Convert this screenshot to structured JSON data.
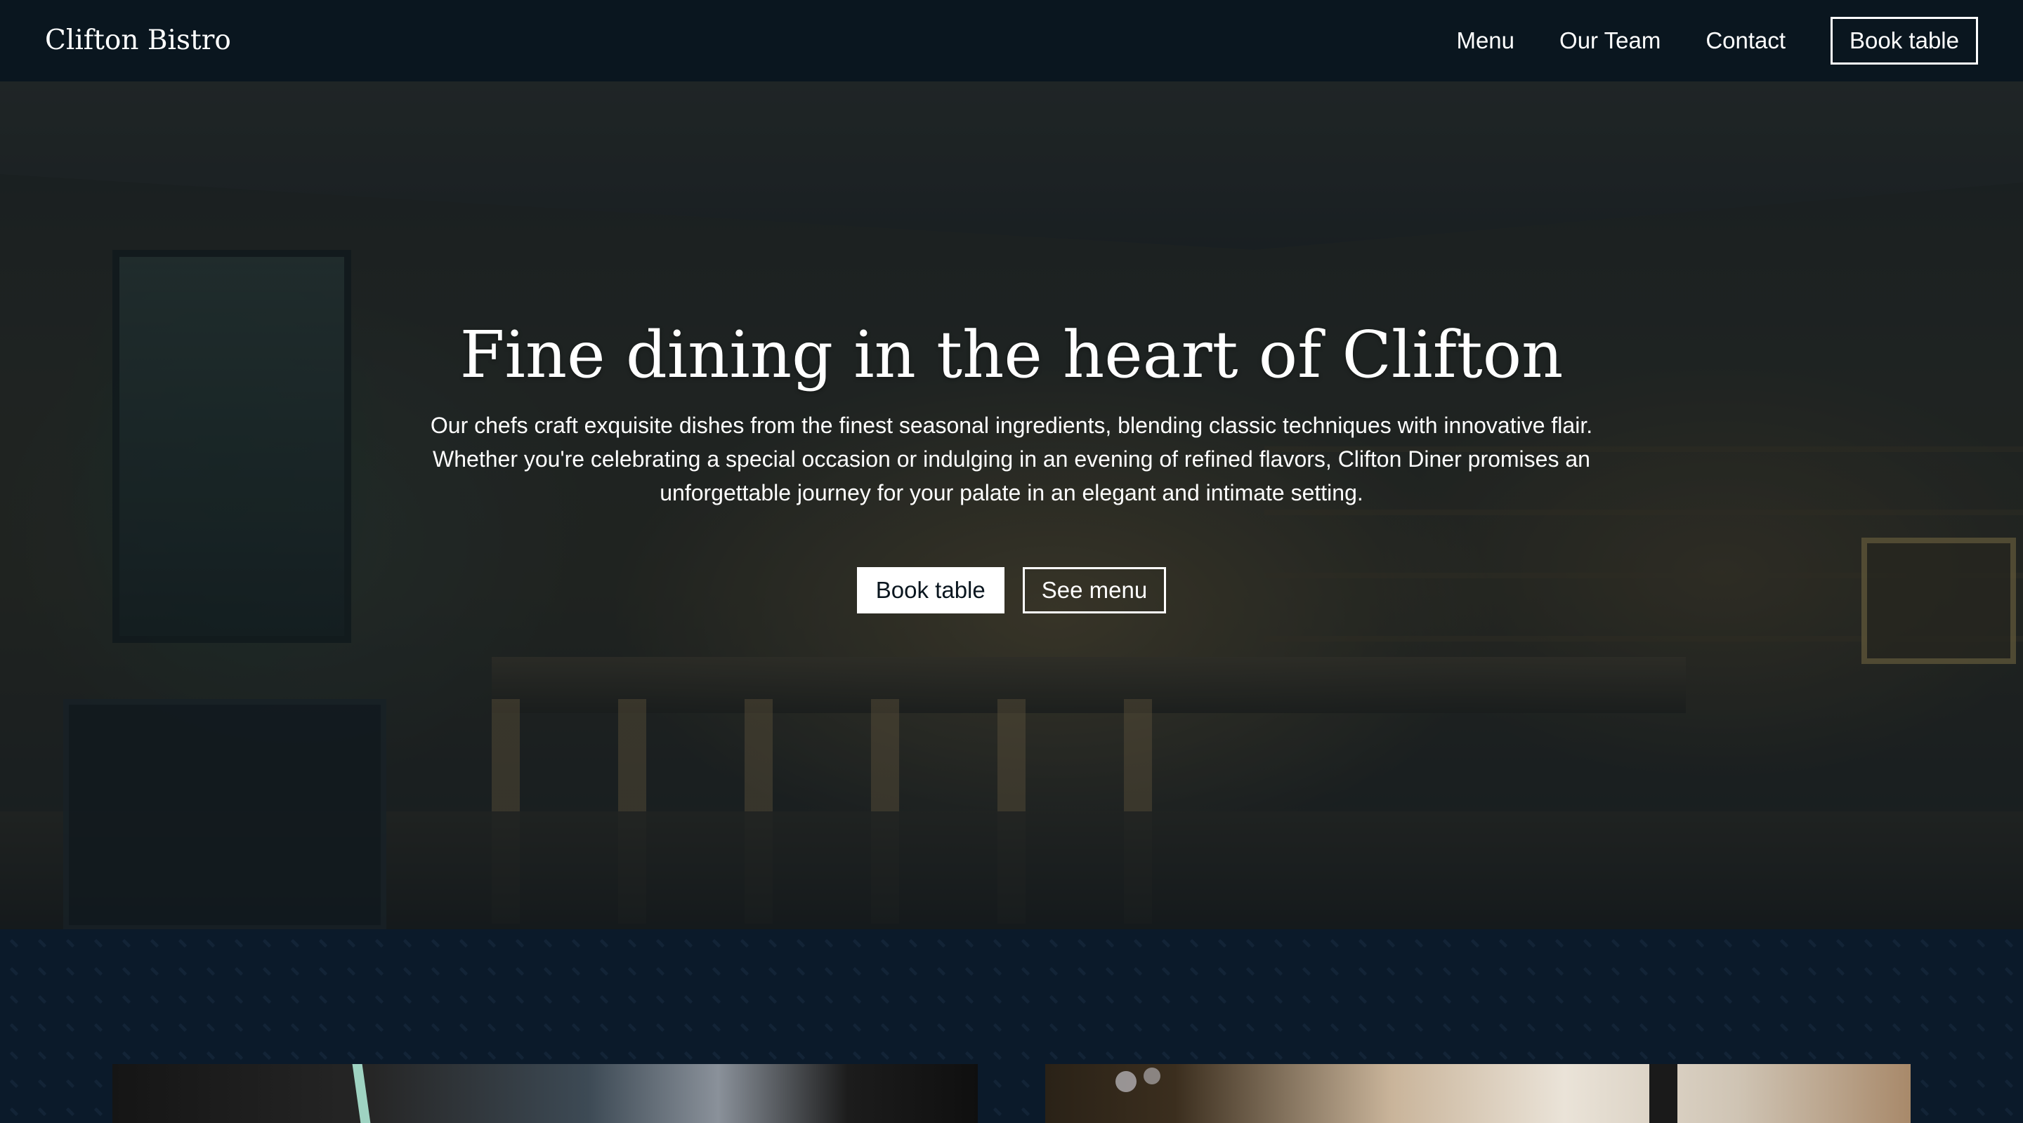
{
  "navbar": {
    "brand": "Clifton Bistro",
    "links": [
      {
        "label": "Menu"
      },
      {
        "label": "Our Team"
      },
      {
        "label": "Contact"
      }
    ],
    "book_label": "Book table"
  },
  "hero": {
    "title": "Fine dining in the heart of Clifton",
    "text": "Our chefs craft exquisite dishes from the finest seasonal ingredients, blending classic techniques with innovative flair. Whether you're celebrating a special occasion or indulging in an evening of refined flavors, Clifton Diner promises an unforgettable journey for your palate in an elegant and intimate setting.",
    "primary_button": "Book table",
    "secondary_button": "See menu"
  },
  "colors": {
    "navbar_bg": "#0a161f",
    "section_bg": "#0b1a2a",
    "text": "#ffffff"
  }
}
